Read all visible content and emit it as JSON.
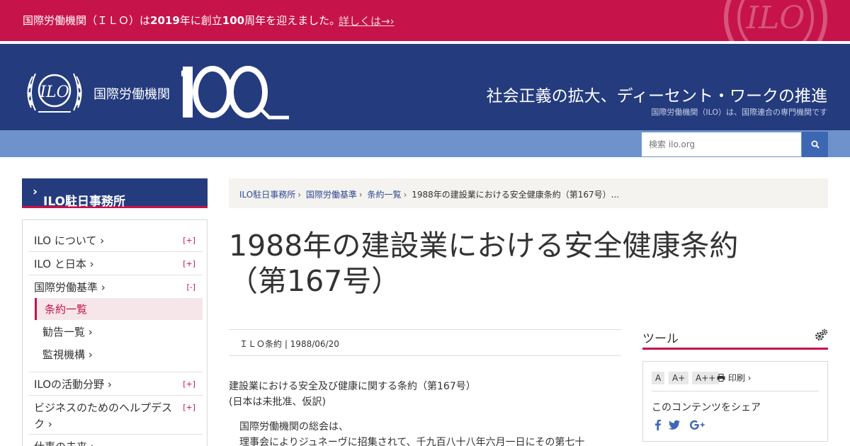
{
  "banner": {
    "text_before": "国際労働機関（ＩＬＯ）は",
    "year": "2019",
    "text_mid": "年に創立",
    "count": "100",
    "text_after": "周年を迎えました。",
    "link": "詳しくは→"
  },
  "header": {
    "org_name": "国際労働機関",
    "logo_text": "ILO",
    "tagline": "社会正義の拡大、ディーセント・ワークの推進",
    "subtagline": "国際労働機関（ILO）は、国際連合の専門機関です"
  },
  "search": {
    "placeholder": "検索 ilo.org"
  },
  "sidebar": {
    "title": "ILO駐日事務所",
    "items": [
      {
        "label": "ILO について",
        "toggle": "[+]"
      },
      {
        "label": "ILO と日本",
        "toggle": "[+]"
      },
      {
        "label": "国際労働基準",
        "toggle": "[-]"
      },
      {
        "label": "ILOの活動分野",
        "toggle": "[+]"
      },
      {
        "label": "ビジネスのためのヘルプデスク",
        "label_line1": "ビジネスのためのヘルプデス",
        "label_line2": "ク",
        "toggle": "[+]"
      },
      {
        "label": "仕事の未来"
      }
    ],
    "subitems": [
      {
        "label": "条約一覧"
      },
      {
        "label": "勧告一覧"
      },
      {
        "label": "監視機構"
      }
    ]
  },
  "breadcrumb": {
    "items": [
      "ILO駐日事務所",
      "国際労働基準",
      "条約一覧"
    ],
    "current": "1988年の建設業における安全健康条約（第167号）..."
  },
  "page": {
    "title_line1": "1988年の建設業における安全健康条約",
    "title_line2": "（第167号）",
    "meta": "ＩＬＯ条約 | 1988/06/20",
    "body": [
      "建設業における安全及び健康に関する条約（第167号）",
      "(日本は未批准、仮訳)",
      "国際労働機関の総会は、",
      "理事会によりジュネーヴに招集されて、千九百八十八年六月一日にその第七十"
    ]
  },
  "tools": {
    "title": "ツール",
    "font_sizes": [
      "A",
      "A+",
      "A++"
    ],
    "print": "印刷",
    "share_label": "このコンテンツをシェア"
  },
  "colors": {
    "brand_red": "#c6134a",
    "brand_navy": "#243b7e",
    "search_strip": "#6e93cc",
    "search_button": "#3d67b3"
  }
}
